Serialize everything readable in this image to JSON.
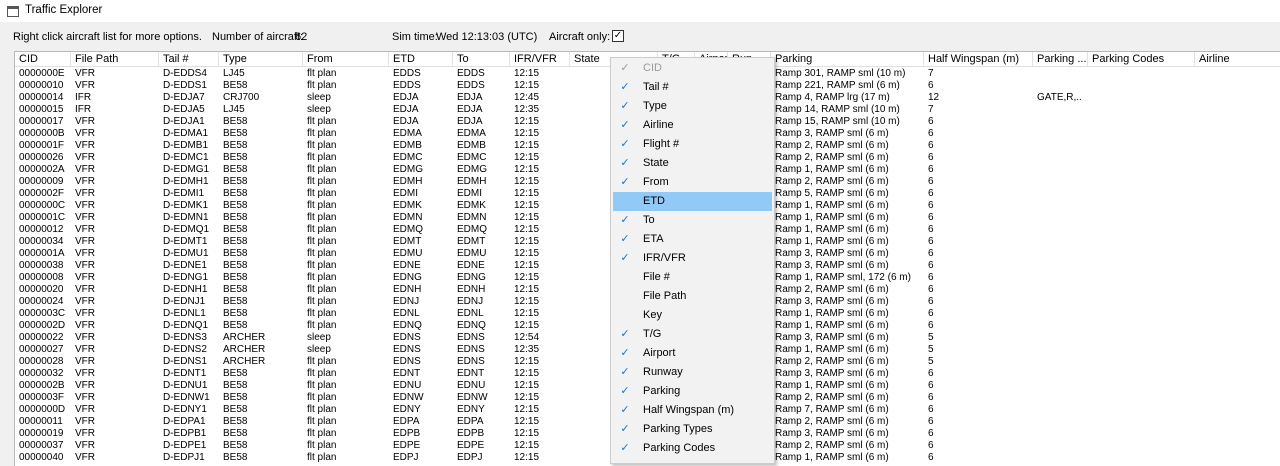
{
  "window": {
    "title": "Traffic Explorer"
  },
  "infobar": {
    "hint": "Right click aircraft list for more options.",
    "count_label": "Number of aircraft:",
    "count": "62",
    "simtime_label": "Sim time:",
    "simtime": "Wed 12:13:03 (UTC)",
    "aircraft_only_label": "Aircraft only:",
    "aircraft_only_mark": "✓"
  },
  "columns": [
    "CID",
    "File Path",
    "Tail #",
    "Type",
    "From",
    "ETD",
    "To",
    "IFR/VFR",
    "State",
    "T/G",
    "Airport",
    "Run",
    "Parking",
    "Half Wingspan (m)",
    "Parking ...",
    "Parking Codes",
    "Airline"
  ],
  "rows": [
    [
      "0000000E",
      "VFR",
      "D-EDDS4",
      "LJ45",
      "flt plan",
      "EDDS",
      "EDDS",
      "12:15",
      "Ramp 301, RAMP sml (10 m)",
      "7",
      ""
    ],
    [
      "00000010",
      "VFR",
      "D-EDDS1",
      "BE58",
      "flt plan",
      "EDDS",
      "EDDS",
      "12:15",
      "Ramp 221, RAMP sml (6 m)",
      "6",
      ""
    ],
    [
      "00000014",
      "IFR",
      "D-EDJA7",
      "CRJ700",
      "sleep",
      "EDJA",
      "EDJA",
      "12:45",
      "Ramp 4, RAMP lrg (17 m)",
      "12",
      "GATE,R,.."
    ],
    [
      "00000015",
      "IFR",
      "D-EDJA5",
      "LJ45",
      "sleep",
      "EDJA",
      "EDJA",
      "12:35",
      "Ramp 14, RAMP sml (10 m)",
      "7",
      ""
    ],
    [
      "00000017",
      "VFR",
      "D-EDJA1",
      "BE58",
      "flt plan",
      "EDJA",
      "EDJA",
      "12:15",
      "Ramp 15, RAMP sml (10 m)",
      "6",
      ""
    ],
    [
      "0000000B",
      "VFR",
      "D-EDMA1",
      "BE58",
      "flt plan",
      "EDMA",
      "EDMA",
      "12:15",
      "Ramp 3, RAMP sml (6 m)",
      "6",
      ""
    ],
    [
      "0000001F",
      "VFR",
      "D-EDMB1",
      "BE58",
      "flt plan",
      "EDMB",
      "EDMB",
      "12:15",
      "Ramp 2, RAMP sml (6 m)",
      "6",
      ""
    ],
    [
      "00000026",
      "VFR",
      "D-EDMC1",
      "BE58",
      "flt plan",
      "EDMC",
      "EDMC",
      "12:15",
      "Ramp 2, RAMP sml (6 m)",
      "6",
      ""
    ],
    [
      "0000002A",
      "VFR",
      "D-EDMG1",
      "BE58",
      "flt plan",
      "EDMG",
      "EDMG",
      "12:15",
      "Ramp 1, RAMP sml (6 m)",
      "6",
      ""
    ],
    [
      "00000009",
      "VFR",
      "D-EDMH1",
      "BE58",
      "flt plan",
      "EDMH",
      "EDMH",
      "12:15",
      "Ramp 2, RAMP sml (6 m)",
      "6",
      ""
    ],
    [
      "0000002F",
      "VFR",
      "D-EDMI1",
      "BE58",
      "flt plan",
      "EDMI",
      "EDMI",
      "12:15",
      "Ramp 5, RAMP sml (6 m)",
      "6",
      ""
    ],
    [
      "0000000C",
      "VFR",
      "D-EDMK1",
      "BE58",
      "flt plan",
      "EDMK",
      "EDMK",
      "12:15",
      "Ramp 1, RAMP sml (6 m)",
      "6",
      ""
    ],
    [
      "0000001C",
      "VFR",
      "D-EDMN1",
      "BE58",
      "flt plan",
      "EDMN",
      "EDMN",
      "12:15",
      "Ramp 1, RAMP sml (6 m)",
      "6",
      ""
    ],
    [
      "00000012",
      "VFR",
      "D-EDMQ1",
      "BE58",
      "flt plan",
      "EDMQ",
      "EDMQ",
      "12:15",
      "Ramp 1, RAMP sml (6 m)",
      "6",
      ""
    ],
    [
      "00000034",
      "VFR",
      "D-EDMT1",
      "BE58",
      "flt plan",
      "EDMT",
      "EDMT",
      "12:15",
      "Ramp 1, RAMP sml (6 m)",
      "6",
      ""
    ],
    [
      "0000001A",
      "VFR",
      "D-EDMU1",
      "BE58",
      "flt plan",
      "EDMU",
      "EDMU",
      "12:15",
      "Ramp 3, RAMP sml (6 m)",
      "6",
      ""
    ],
    [
      "00000038",
      "VFR",
      "D-EDNE1",
      "BE58",
      "flt plan",
      "EDNE",
      "EDNE",
      "12:15",
      "Ramp 3, RAMP sml (6 m)",
      "6",
      ""
    ],
    [
      "00000008",
      "VFR",
      "D-EDNG1",
      "BE58",
      "flt plan",
      "EDNG",
      "EDNG",
      "12:15",
      "Ramp 1, RAMP sml, 172 (6 m)",
      "6",
      ""
    ],
    [
      "00000020",
      "VFR",
      "D-EDNH1",
      "BE58",
      "flt plan",
      "EDNH",
      "EDNH",
      "12:15",
      "Ramp 2, RAMP sml (6 m)",
      "6",
      ""
    ],
    [
      "00000024",
      "VFR",
      "D-EDNJ1",
      "BE58",
      "flt plan",
      "EDNJ",
      "EDNJ",
      "12:15",
      "Ramp 3, RAMP sml (6 m)",
      "6",
      ""
    ],
    [
      "0000003C",
      "VFR",
      "D-EDNL1",
      "BE58",
      "flt plan",
      "EDNL",
      "EDNL",
      "12:15",
      "Ramp 1, RAMP sml (6 m)",
      "6",
      ""
    ],
    [
      "0000002D",
      "VFR",
      "D-EDNQ1",
      "BE58",
      "flt plan",
      "EDNQ",
      "EDNQ",
      "12:15",
      "Ramp 1, RAMP sml (6 m)",
      "6",
      ""
    ],
    [
      "00000022",
      "VFR",
      "D-EDNS3",
      "ARCHER",
      "sleep",
      "EDNS",
      "EDNS",
      "12:54",
      "Ramp 3, RAMP sml (6 m)",
      "5",
      ""
    ],
    [
      "00000027",
      "VFR",
      "D-EDNS2",
      "ARCHER",
      "sleep",
      "EDNS",
      "EDNS",
      "12:35",
      "Ramp 1, RAMP sml (6 m)",
      "5",
      ""
    ],
    [
      "00000028",
      "VFR",
      "D-EDNS1",
      "ARCHER",
      "flt plan",
      "EDNS",
      "EDNS",
      "12:15",
      "Ramp 2, RAMP sml (6 m)",
      "5",
      ""
    ],
    [
      "00000032",
      "VFR",
      "D-EDNT1",
      "BE58",
      "flt plan",
      "EDNT",
      "EDNT",
      "12:15",
      "Ramp 3, RAMP sml (6 m)",
      "6",
      ""
    ],
    [
      "0000002B",
      "VFR",
      "D-EDNU1",
      "BE58",
      "flt plan",
      "EDNU",
      "EDNU",
      "12:15",
      "Ramp 1, RAMP sml (6 m)",
      "6",
      ""
    ],
    [
      "0000003F",
      "VFR",
      "D-EDNW1",
      "BE58",
      "flt plan",
      "EDNW",
      "EDNW",
      "12:15",
      "Ramp 2, RAMP sml (6 m)",
      "6",
      ""
    ],
    [
      "0000000D",
      "VFR",
      "D-EDNY1",
      "BE58",
      "flt plan",
      "EDNY",
      "EDNY",
      "12:15",
      "Ramp 7, RAMP sml (6 m)",
      "6",
      ""
    ],
    [
      "00000011",
      "VFR",
      "D-EDPA1",
      "BE58",
      "flt plan",
      "EDPA",
      "EDPA",
      "12:15",
      "Ramp 2, RAMP sml (6 m)",
      "6",
      ""
    ],
    [
      "00000019",
      "VFR",
      "D-EDPB1",
      "BE58",
      "flt plan",
      "EDPB",
      "EDPB",
      "12:15",
      "Ramp 3, RAMP sml (6 m)",
      "6",
      ""
    ],
    [
      "00000037",
      "VFR",
      "D-EDPE1",
      "BE58",
      "flt plan",
      "EDPE",
      "EDPE",
      "12:15",
      "Ramp 2, RAMP sml (6 m)",
      "6",
      ""
    ],
    [
      "00000040",
      "VFR",
      "D-EDPJ1",
      "BE58",
      "flt plan",
      "EDPJ",
      "EDPJ",
      "12:15",
      "Ramp 1, RAMP sml (6 m)",
      "6",
      ""
    ]
  ],
  "context_menu": {
    "items": [
      {
        "label": "CID",
        "checked": true,
        "disabled": true
      },
      {
        "label": "Tail #",
        "checked": true
      },
      {
        "label": "Type",
        "checked": true
      },
      {
        "label": "Airline",
        "checked": true
      },
      {
        "label": "Flight #",
        "checked": true
      },
      {
        "label": "State",
        "checked": true
      },
      {
        "label": "From",
        "checked": true
      },
      {
        "label": "ETD",
        "checked": false,
        "highlighted": true
      },
      {
        "label": "To",
        "checked": true
      },
      {
        "label": "ETA",
        "checked": true
      },
      {
        "label": "IFR/VFR",
        "checked": true
      },
      {
        "label": "File #",
        "checked": false
      },
      {
        "label": "File Path",
        "checked": false
      },
      {
        "label": "Key",
        "checked": false
      },
      {
        "label": "T/G",
        "checked": true
      },
      {
        "label": "Airport",
        "checked": true
      },
      {
        "label": "Runway",
        "checked": true
      },
      {
        "label": "Parking",
        "checked": true
      },
      {
        "label": "Half Wingspan (m)",
        "checked": true
      },
      {
        "label": "Parking Types",
        "checked": true
      },
      {
        "label": "Parking Codes",
        "checked": true
      }
    ],
    "check_glyph": "✓"
  }
}
